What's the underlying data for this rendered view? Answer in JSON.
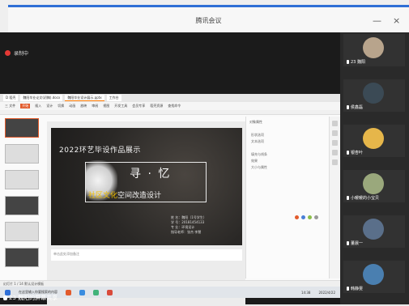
{
  "window": {
    "title": "腾讯会议",
    "minimize_glyph": "—",
    "close_glyph": "×"
  },
  "meeting": {
    "recording_label": "录制中",
    "screen_share_label": "23 魏阳的屏幕共享"
  },
  "shared_screen": {
    "browser_tabs": [
      "D 稻壳",
      "魏阳毕业论文(初稿).docx",
      "魏阳毕业设计展示.pptx",
      "工作台"
    ],
    "ribbon_items": [
      "三 文件",
      "开始",
      "插入",
      "设计",
      "切换",
      "动画",
      "放映",
      "审阅",
      "视图",
      "开发工具",
      "会员专享",
      "稻壳资源",
      "查找命令"
    ],
    "slide": {
      "heading": "2022环艺毕设作品展示",
      "title": "寻 · 忆",
      "subtitle_accent": "社区文化",
      "subtitle_rest": "空间改造设计",
      "info_lines": [
        "姓    名：魏阳（1号学生）",
        "学    号：20181454133",
        "专    业：环境设计",
        "指导老师：张杰  李慧"
      ]
    },
    "notes_placeholder": "单击此处添加备注",
    "right_pane": {
      "title": "对象属性",
      "options": [
        "形状选项",
        "文本选项",
        "填充与线条",
        "效果",
        "大小与属性"
      ]
    },
    "status_text": "幻灯片 1 / 14   默认设计模板",
    "taskbar": {
      "search_placeholder": "在这里输入你要搜索的内容",
      "time": "14:38",
      "date": "2022/4/22"
    }
  },
  "participants": [
    {
      "name": "23 魏阳",
      "avatar_color": "#b8a48c"
    },
    {
      "name": "侯鑫磊",
      "avatar_color": "#3b4a55"
    },
    {
      "name": "银杏叶",
      "avatar_color": "#e6b64a"
    },
    {
      "name": "小暖暖的小宝贝",
      "avatar_color": "#9aa87c"
    },
    {
      "name": "董晨一",
      "avatar_color": "#5a6f8a"
    },
    {
      "name": "韩静雯",
      "avatar_color": "#4a7fb0"
    }
  ],
  "accent_colors": {
    "meeting_blue": "#2f6fd6",
    "recording_red": "#e53935",
    "wps_orange": "#e25b2c",
    "slide_accent": "#f3c100"
  }
}
